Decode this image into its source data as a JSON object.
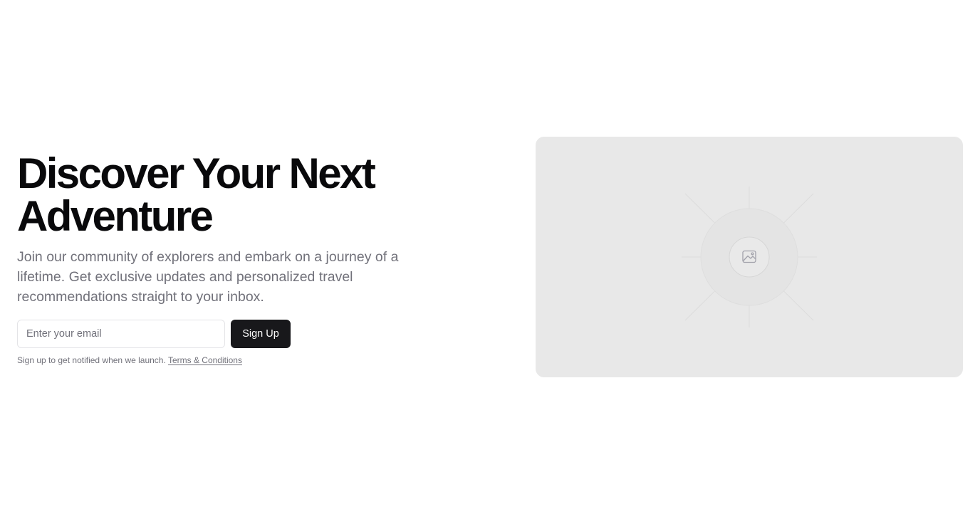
{
  "hero": {
    "title": "Discover Your Next Adventure",
    "subtitle": "Join our community of explorers and embark on a journey of a lifetime. Get exclusive updates and personalized travel recommendations straight to your inbox."
  },
  "form": {
    "email_placeholder": "Enter your email",
    "email_value": "",
    "submit_label": "Sign Up"
  },
  "notice": {
    "text": "Sign up to get notified when we launch.",
    "link_label": "Terms & Conditions"
  },
  "media": {
    "icon": "image-icon",
    "background_color": "#e8e8e8"
  },
  "colors": {
    "heading": "#09090b",
    "muted_text": "#71717a",
    "button_bg": "#18181b",
    "button_text": "#fafafa",
    "input_border": "#e4e4e7"
  }
}
